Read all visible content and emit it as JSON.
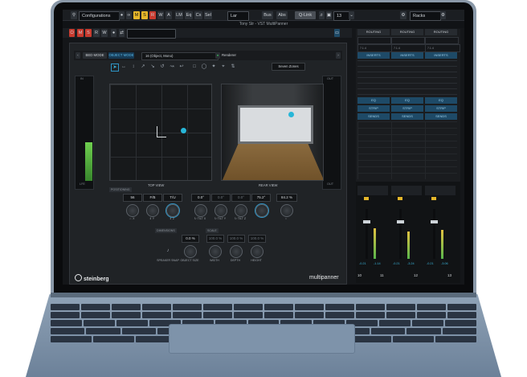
{
  "toolbar": {
    "config_label": "Configurations",
    "m": "M",
    "s": "S",
    "r": "R",
    "w": "W",
    "a": "A",
    "lm": "LM",
    "eq": "Eq",
    "cs": "Cs",
    "sel": "Sel",
    "lar": "Lar",
    "bus": "Bus",
    "abs": "Abs",
    "qlink": "Q-Link",
    "num13": "13",
    "racks": "Racks"
  },
  "window_title": "Tony Str - VST MultiPanner",
  "row3": {
    "m": "M",
    "s": "S",
    "r": "R",
    "w": "W"
  },
  "plugin": {
    "bed_mode": "BED MODE",
    "object_mode": "OBJECT MODE",
    "object_select": "16 (Object, Mono)",
    "renderer": "Renderer",
    "view_select": "Seven Zones",
    "top_view": "TOP VIEW",
    "rear_view": "REAR VIEW",
    "meter_left": {
      "top": "IN",
      "bottom": "LFE",
      "ticks": [
        "0",
        "-6",
        "-12",
        "-18",
        "-24",
        "-30",
        "-36",
        "-42",
        "-48",
        "-54",
        "-60"
      ]
    },
    "meter_right": {
      "top": "OUT",
      "bottom": "OUT"
    },
    "positioning_label": "POSITIONING",
    "fields": [
      "56",
      "F/B",
      "T/U",
      "0.0°",
      "0.0°",
      "0.0°",
      "75.2°",
      "84.2 %"
    ],
    "knob_labels": [
      "⇔ X",
      "⇕ Y",
      "⇕ Z",
      "↻ TILT X",
      "↻ TILT Y",
      "↻ TILT Z",
      "○"
    ],
    "dimensions_label": "DIMENSIONS",
    "scale_label": "SCALE",
    "dim_fields": [
      "0.0 %",
      "100.0 %",
      "100.0 %",
      "100.0 %"
    ],
    "speaker_snap": "SPEAKER SNAP",
    "object_size": "OBJECT SIZE",
    "width": "WIDTH",
    "depth": "DEPTH",
    "height": "HEIGHT",
    "brand": "steinberg",
    "product": "multipanner"
  },
  "mixer": {
    "routing": [
      "ROUTING",
      "ROUTING",
      "ROUTING"
    ],
    "slots_top": [
      "7.1.4",
      "7.1.4",
      "7.1.4"
    ],
    "inserts": [
      "INSERTS",
      "INSERTS",
      "INSERTS"
    ],
    "eq": [
      "EQ",
      "EQ",
      "EQ"
    ],
    "strip": [
      "STRIP",
      "STRIP",
      "STRIP"
    ],
    "sends": [
      "SENDS",
      "SENDS",
      "SENDS"
    ],
    "values": [
      "-0.21",
      "-1.14",
      "-0.21",
      "-3.24",
      "-0.21",
      "-3.06"
    ],
    "channels": [
      "10",
      "11",
      "12",
      "13"
    ]
  }
}
